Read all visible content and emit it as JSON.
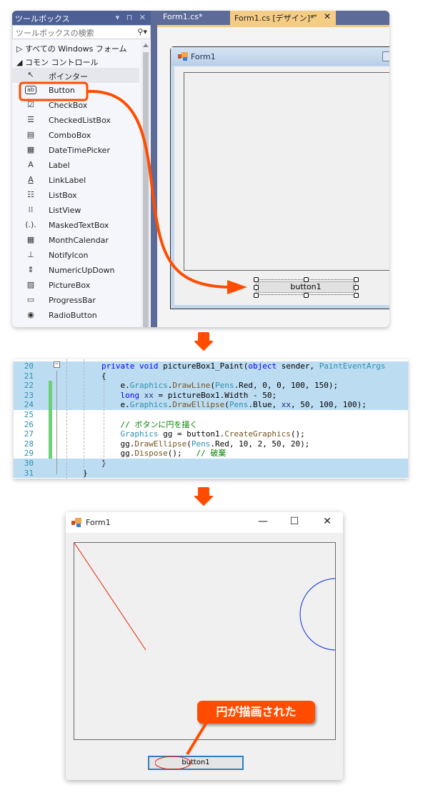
{
  "toolbox": {
    "title": "ツールボックス",
    "title_buttons": "▾ ⊓ ✕",
    "search_placeholder": "ツールボックスの検索",
    "search_icon": "search-icon",
    "categories": [
      {
        "label": "▷ すべての Windows フォーム",
        "expanded": false
      },
      {
        "label": "◢ コモン コントロール",
        "expanded": true
      }
    ],
    "items": [
      {
        "label": "ポインター",
        "icon": "pointer-icon",
        "glyph": "↖"
      },
      {
        "label": "Button",
        "icon": "button-icon",
        "glyph": "ab"
      },
      {
        "label": "CheckBox",
        "icon": "checkbox-icon",
        "glyph": "☑"
      },
      {
        "label": "CheckedListBox",
        "icon": "checked-list-box-icon",
        "glyph": "☰"
      },
      {
        "label": "ComboBox",
        "icon": "combobox-icon",
        "glyph": "▤"
      },
      {
        "label": "DateTimePicker",
        "icon": "datetime-picker-icon",
        "glyph": "▦"
      },
      {
        "label": "Label",
        "icon": "label-icon",
        "glyph": "A"
      },
      {
        "label": "LinkLabel",
        "icon": "link-label-icon",
        "glyph": "A"
      },
      {
        "label": "ListBox",
        "icon": "listbox-icon",
        "glyph": "☷"
      },
      {
        "label": "ListView",
        "icon": "listview-icon",
        "glyph": "⁞⁞"
      },
      {
        "label": "MaskedTextBox",
        "icon": "masked-textbox-icon",
        "glyph": "(.)."
      },
      {
        "label": "MonthCalendar",
        "icon": "month-calendar-icon",
        "glyph": "▦"
      },
      {
        "label": "NotifyIcon",
        "icon": "notify-icon-icon",
        "glyph": "⊥"
      },
      {
        "label": "NumericUpDown",
        "icon": "numeric-updown-icon",
        "glyph": "⇕"
      },
      {
        "label": "PictureBox",
        "icon": "picturebox-icon",
        "glyph": "▨"
      },
      {
        "label": "ProgressBar",
        "icon": "progressbar-icon",
        "glyph": "▭"
      },
      {
        "label": "RadioButton",
        "icon": "radiobutton-icon",
        "glyph": "◉"
      }
    ]
  },
  "editor": {
    "tabs": [
      {
        "label": "Form1.cs*",
        "active": false
      },
      {
        "label": "Form1.cs [デザイン]*",
        "active": true,
        "pin": "⊸",
        "close": "✕"
      }
    ],
    "designer_form": {
      "title": "Form1",
      "button_label": "button1"
    }
  },
  "code": {
    "lines": [
      {
        "n": "20",
        "text": "private void pictureBox1_Paint(object sender, PaintEventArgs",
        "highlight": true,
        "changed": false
      },
      {
        "n": "21",
        "text": "{",
        "highlight": true,
        "changed": false
      },
      {
        "n": "22",
        "text": "    e.Graphics.DrawLine(Pens.Red, 0, 0, 100, 150);",
        "highlight": true,
        "changed": true
      },
      {
        "n": "23",
        "text": "    long xx = pictureBox1.Width - 50;",
        "highlight": true,
        "changed": true
      },
      {
        "n": "24",
        "text": "    e.Graphics.DrawEllipse(Pens.Blue, xx, 50, 100, 100);",
        "highlight": true,
        "changed": true
      },
      {
        "n": "25",
        "text": "",
        "highlight": false,
        "changed": true
      },
      {
        "n": "26",
        "text": "    // ボタンに円を描く",
        "highlight": false,
        "changed": true
      },
      {
        "n": "27",
        "text": "    Graphics gg = button1.CreateGraphics();",
        "highlight": false,
        "changed": true
      },
      {
        "n": "28",
        "text": "    gg.DrawEllipse(Pens.Red, 10, 2, 50, 20);",
        "highlight": false,
        "changed": true
      },
      {
        "n": "29",
        "text": "    gg.Dispose();   // 破棄",
        "highlight": false,
        "changed": true
      },
      {
        "n": "30",
        "text": "}",
        "highlight": true,
        "changed": false
      },
      {
        "n": "31",
        "text": "}",
        "highlight": true,
        "changed": false
      }
    ]
  },
  "runtime_form": {
    "title": "Form1",
    "min_glyph": "—",
    "max_glyph": "☐",
    "close_glyph": "✕",
    "button_label": "button1",
    "callout": "円が描画された"
  },
  "colors": {
    "accent_orange": "#ff4c00",
    "vs_blue": "#5d6b99",
    "active_tab": "#f5cc84",
    "line_red": "#e8200c",
    "ellipse_blue": "#0b2fd6",
    "code_highlight": "#bcdcf2",
    "change_green": "#6dd177"
  }
}
